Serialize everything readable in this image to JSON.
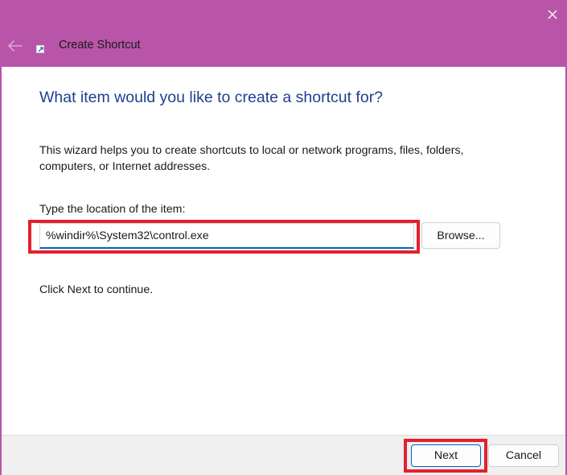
{
  "window": {
    "title": "Create Shortcut",
    "accent_color": "#b955a8"
  },
  "icons": {
    "back": "arrow-left-icon",
    "app": "shortcut-icon",
    "close": "close-icon"
  },
  "wizard": {
    "heading": "What item would you like to create a shortcut for?",
    "description": "This wizard helps you to create shortcuts to local or network programs, files, folders, computers, or Internet addresses.",
    "location_label": "Type the location of the item:",
    "location_value": "%windir%\\System32\\control.exe",
    "browse_label": "Browse...",
    "continue_text": "Click Next to continue."
  },
  "footer": {
    "next_label": "Next",
    "cancel_label": "Cancel"
  },
  "highlight_color": "#e4202e"
}
